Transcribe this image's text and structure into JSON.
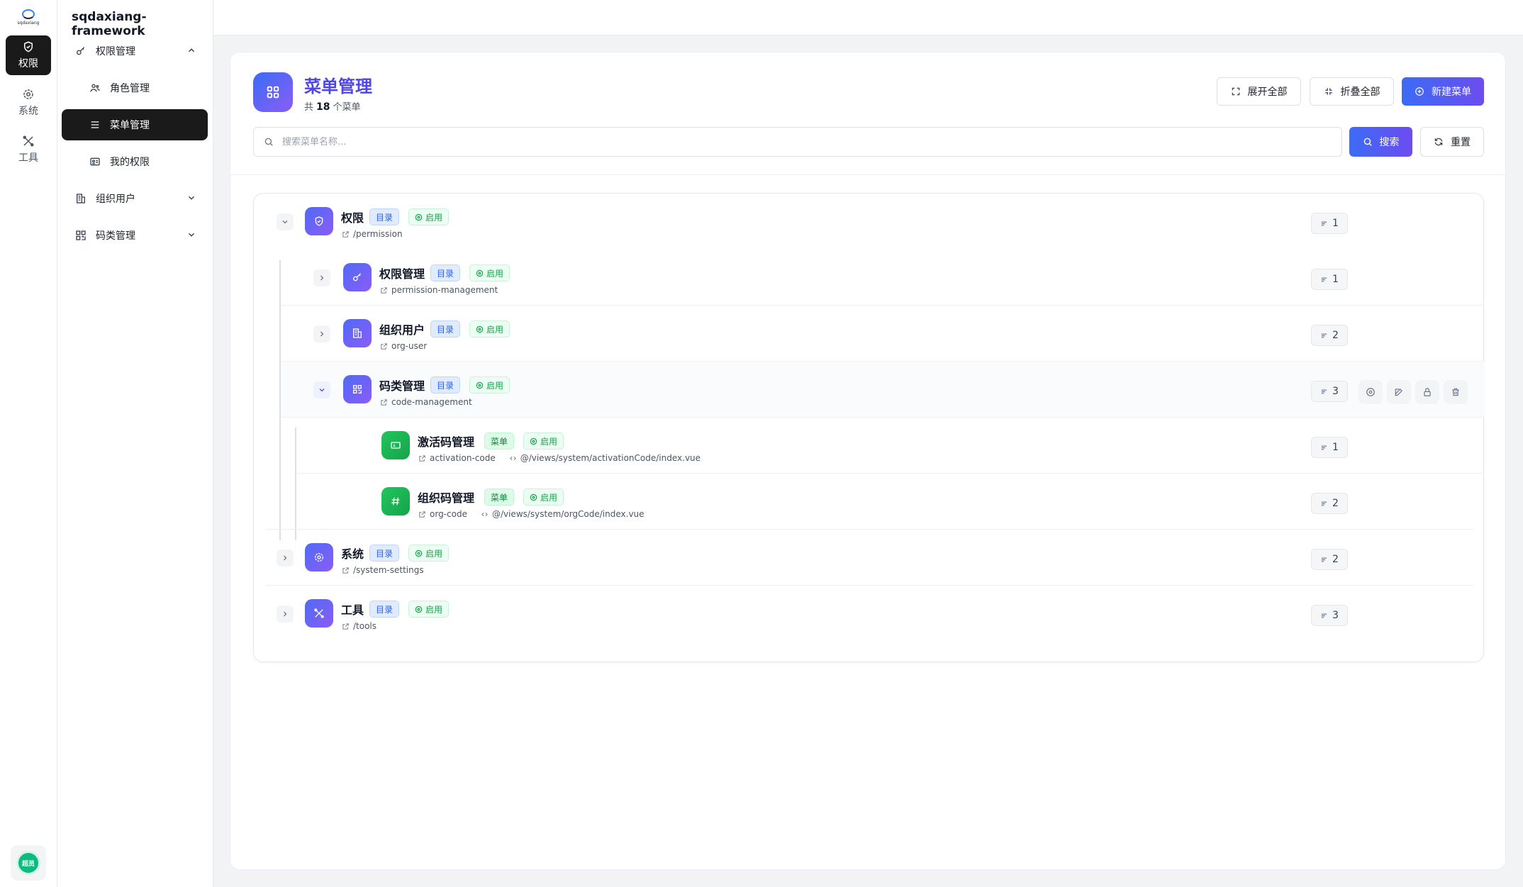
{
  "app": {
    "logo_text": "sqdaxiang",
    "title": "sqdaxiang-framework",
    "avatar_text": "超员"
  },
  "rail": [
    {
      "label": "权限",
      "icon": "shield-icon",
      "active": true
    },
    {
      "label": "系统",
      "icon": "gear-icon",
      "active": false
    },
    {
      "label": "工具",
      "icon": "tools-icon",
      "active": false
    }
  ],
  "subnav": {
    "items": [
      {
        "label": "权限管理",
        "icon": "key-icon",
        "level": 1,
        "expanded": true
      },
      {
        "label": "角色管理",
        "icon": "users-icon",
        "level": 2
      },
      {
        "label": "菜单管理",
        "icon": "menu-lines-icon",
        "level": 2,
        "active": true
      },
      {
        "label": "我的权限",
        "icon": "id-card-icon",
        "level": 2
      },
      {
        "label": "组织用户",
        "icon": "building-icon",
        "level": 1,
        "expanded": false
      },
      {
        "label": "码类管理",
        "icon": "qrcode-icon",
        "level": 1,
        "expanded": false
      }
    ]
  },
  "page": {
    "title": "菜单管理",
    "count_prefix": "共",
    "count": "18",
    "count_suffix": "个菜单",
    "expand_all": "展开全部",
    "collapse_all": "折叠全部",
    "new_menu": "新建菜单",
    "search_placeholder": "搜索菜单名称...",
    "search_value": "",
    "search_btn": "搜索",
    "reset_btn": "重置"
  },
  "tree": [
    {
      "name": "权限",
      "type": "目录",
      "status": "启用",
      "path": "/permission",
      "component": "",
      "sort": "1",
      "depth": 0,
      "expanded": true,
      "kind": "dir",
      "icon": "shield-icon"
    },
    {
      "name": "权限管理",
      "type": "目录",
      "status": "启用",
      "path": "permission-management",
      "component": "",
      "sort": "1",
      "depth": 1,
      "expanded": false,
      "kind": "dir",
      "icon": "key-icon"
    },
    {
      "name": "组织用户",
      "type": "目录",
      "status": "启用",
      "path": "org-user",
      "component": "",
      "sort": "2",
      "depth": 1,
      "expanded": false,
      "kind": "dir",
      "icon": "building-icon"
    },
    {
      "name": "码类管理",
      "type": "目录",
      "status": "启用",
      "path": "code-management",
      "component": "",
      "sort": "3",
      "depth": 1,
      "expanded": true,
      "kind": "dir",
      "icon": "qrcode-icon"
    },
    {
      "name": "激活码管理",
      "type": "菜单",
      "status": "启用",
      "path": "activation-code",
      "component": "@/views/system/activationCode/index.vue",
      "sort": "1",
      "depth": 2,
      "kind": "menu",
      "icon": "ticket-icon"
    },
    {
      "name": "组织码管理",
      "type": "菜单",
      "status": "启用",
      "path": "org-code",
      "component": "@/views/system/orgCode/index.vue",
      "sort": "2",
      "depth": 2,
      "kind": "menu",
      "icon": "hash-icon"
    },
    {
      "name": "系统",
      "type": "目录",
      "status": "启用",
      "path": "/system-settings",
      "component": "",
      "sort": "2",
      "depth": 0,
      "expanded": false,
      "kind": "dir",
      "icon": "gear-icon"
    },
    {
      "name": "工具",
      "type": "目录",
      "status": "启用",
      "path": "/tools",
      "component": "",
      "sort": "3",
      "depth": 0,
      "expanded": false,
      "kind": "dir",
      "icon": "tools-icon"
    }
  ],
  "colors": {
    "accent": "#4f46e5",
    "primary_gradient_start": "#3b6cf6",
    "primary_gradient_end": "#6d4cf0",
    "status_green": "#16a34a",
    "dir_tag_blue": "#2563eb"
  }
}
